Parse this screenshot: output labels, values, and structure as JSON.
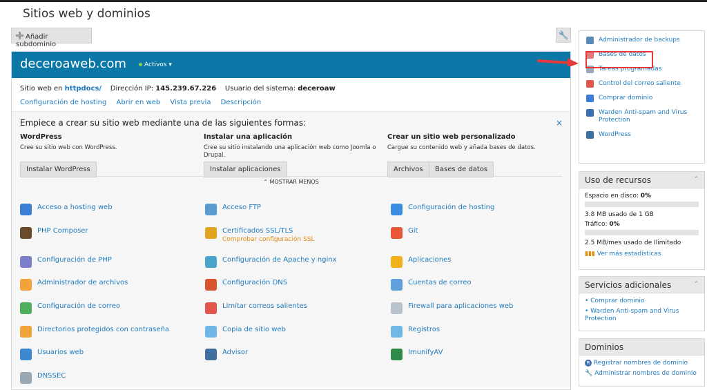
{
  "page": {
    "title": "Sitios web y dominios"
  },
  "toolbar": {
    "add_subdomain": "Añadir subdominio",
    "tool_icon": "wrench-icon"
  },
  "domain": {
    "name": "deceroaweb.com",
    "status": "Activos",
    "site_label": "Sitio web en",
    "site_path": "httpdocs/",
    "ip_label": "Dirección IP:",
    "ip": "145.239.67.226",
    "user_label": "Usuario del sistema:",
    "user": "deceroaw",
    "links": [
      "Configuración de hosting",
      "Abrir en web",
      "Vista previa",
      "Descripción"
    ]
  },
  "start": {
    "title": "Empiece a crear su sitio web mediante una de las siguientes formas:",
    "close": "×",
    "columns": [
      {
        "heading": "WordPress",
        "desc": "Cree su sitio web con WordPress.",
        "buttons": [
          "Instalar WordPress"
        ]
      },
      {
        "heading": "Instalar una aplicación",
        "desc": "Cree su sitio instalando una aplicación web como Joomla o Drupal.",
        "buttons": [
          "Instalar aplicaciones"
        ]
      },
      {
        "heading": "Crear un sitio web personalizado",
        "desc": "Cargue su contenido web y añada bases de datos.",
        "buttons": [
          "Archivos",
          "Bases de datos"
        ]
      }
    ],
    "show_less": "⌃ MOSTRAR MENOS"
  },
  "features": [
    {
      "label": "Acceso a hosting web",
      "icon": "globe-user-icon",
      "color": "#3a7fd5"
    },
    {
      "label": "Acceso FTP",
      "icon": "ftp-computer-icon",
      "color": "#5a9bd0"
    },
    {
      "label": "Configuración de hosting",
      "icon": "hosting-settings-icon",
      "color": "#3a8de0"
    },
    {
      "label": "PHP Composer",
      "icon": "composer-icon",
      "color": "#6b4a2b"
    },
    {
      "label": "Certificados SSL/TLS",
      "sub": "Comprobar configuración SSL",
      "icon": "ssl-lock-icon",
      "color": "#e0a41f"
    },
    {
      "label": "Git",
      "icon": "git-icon",
      "color": "#e8573a"
    },
    {
      "label": "Configuración de PHP",
      "icon": "php-icon",
      "color": "#7b7fc9"
    },
    {
      "label": "Configuración de Apache y nginx",
      "icon": "apache-nginx-icon",
      "color": "#4aa3c9"
    },
    {
      "label": "Aplicaciones",
      "icon": "applications-gear-icon",
      "color": "#f0b21a"
    },
    {
      "label": "Administrador de archivos",
      "icon": "folder-icon",
      "color": "#f2a23a"
    },
    {
      "label": "Configuración DNS",
      "icon": "dns-icon",
      "color": "#d9532f"
    },
    {
      "label": "Cuentas de correo",
      "icon": "mail-accounts-icon",
      "color": "#5fa0dd"
    },
    {
      "label": "Configuración de correo",
      "icon": "mail-settings-icon",
      "color": "#4fae5b"
    },
    {
      "label": "Limitar correos salientes",
      "icon": "outgoing-mail-icon",
      "color": "#e2574c"
    },
    {
      "label": "Firewall para aplicaciones web",
      "icon": "shield-icon",
      "color": "#b8c2cc"
    },
    {
      "label": "Directorios protegidos con contraseña",
      "icon": "protected-folder-icon",
      "color": "#f0a53a"
    },
    {
      "label": "Copia de sitio web",
      "icon": "copy-site-icon",
      "color": "#6fb7e8"
    },
    {
      "label": "Registros",
      "icon": "logs-icon",
      "color": "#72b8e6"
    },
    {
      "label": "Usuarios web",
      "icon": "web-users-icon",
      "color": "#3c86d2"
    },
    {
      "label": "Advisor",
      "icon": "advisor-icon",
      "color": "#3e6f9e"
    },
    {
      "label": "ImunifyAV",
      "icon": "imunify-icon",
      "color": "#2f8a4a"
    },
    {
      "label": "DNSSEC",
      "icon": "dnssec-icon",
      "color": "#98a8b4"
    }
  ],
  "quick": [
    {
      "label": "Administrador de backups",
      "icon": "backup-icon",
      "color": "#5c8ab8"
    },
    {
      "label": "Bases de datos",
      "icon": "database-icon",
      "color": "#e37b7b"
    },
    {
      "label": "Tareas programadas",
      "icon": "scheduled-tasks-icon",
      "color": "#9aa9b8"
    },
    {
      "label": "Control del correo saliente",
      "icon": "outgoing-mail-icon",
      "color": "#e2574c"
    },
    {
      "label": "Comprar dominio",
      "icon": "buy-domain-icon",
      "color": "#3a7fd5"
    },
    {
      "label": "Warden Anti-spam and Virus Protection",
      "icon": "warden-icon",
      "color": "#3a6fb0"
    },
    {
      "label": "WordPress",
      "icon": "wordpress-icon",
      "color": "#3a6fa0"
    }
  ],
  "resources": {
    "title": "Uso de recursos",
    "disk_label": "Espacio en disco:",
    "disk_value": "0%",
    "disk_detail": "3.8 MB usado de 1 GB",
    "traffic_label": "Tráfico:",
    "traffic_value": "0%",
    "traffic_detail": "2.5 MB/mes usado de Ilimitado",
    "more_stats": "Ver más estadísticas"
  },
  "services": {
    "title": "Servicios adicionales",
    "items": [
      "Comprar dominio",
      "Warden Anti-spam and Virus Protection"
    ]
  },
  "domains": {
    "title": "Dominios",
    "items": [
      "Registrar nombres de dominio",
      "Administrar nombres de dominio"
    ]
  },
  "colors": {
    "header": "#0b78a8",
    "link": "#1f7bbf",
    "highlight": "#e63a3a"
  }
}
